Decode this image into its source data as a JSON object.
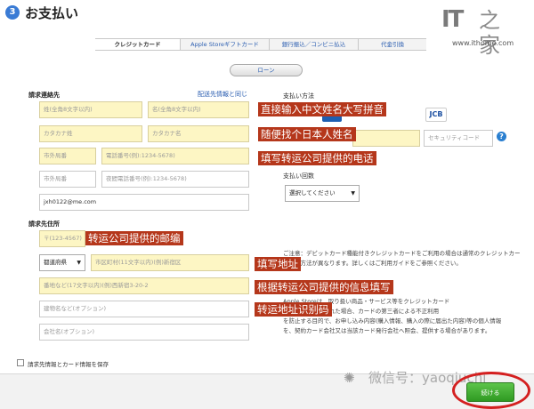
{
  "header": {
    "step_number": "3",
    "title": "お支払い"
  },
  "logo": {
    "it_text": "IT",
    "mark_text": "之家",
    "url": "www.ithome.com"
  },
  "tabs": [
    {
      "label": "クレジットカード",
      "active": true
    },
    {
      "label": "Apple Storeギフトカード",
      "active": false
    },
    {
      "label": "銀行振込／コンビニ払込",
      "active": false
    },
    {
      "label": "代金引換",
      "active": false
    }
  ],
  "loan_button": "ローン",
  "billing": {
    "section_label": "請求連絡先",
    "same_as_link": "配送先情報と同じ",
    "last_name_placeholder": "姓(全角8文字以内)",
    "first_name_placeholder": "名(全角8文字以内)",
    "last_kana_placeholder": "カタカナ姓",
    "first_kana_placeholder": "カタカナ名",
    "area_code_placeholder": "市外局番",
    "phone_placeholder": "電話番号(例):1234-5678)",
    "area_code2_placeholder": "市外局番",
    "phone2_placeholder": "夜間電話番号(例):1234-5678)",
    "email_value": "jxh0122@me.com"
  },
  "address": {
    "section_label": "請求先住所",
    "zip_placeholder": "〒(123-4567)",
    "prefecture_value": "都道府県",
    "city_placeholder": "市区町村(11文字以内)(例)新宿区",
    "street_placeholder": "番地など(17文字以内)(例)西新宿3-20-2",
    "building_placeholder": "建物名など(オプション)",
    "company_placeholder": "会社名(オプション)"
  },
  "payment": {
    "section_label": "支払い方法",
    "security_code_placeholder": "セキュリティコード",
    "help_icon_text": "?",
    "jcb_label": "JCB",
    "installments_label": "支払い回数",
    "installments_select": "選択してください",
    "note_paragraph_1": "ご注意：デビットカード種能付きクレジットカードをご利用の場合は通常のクレジットカー\n手続き方法が異なります。詳しくはご利用ガイドをご参照ください。",
    "note_paragraph_2": "Apple Storeは、取り扱い商品・サービス等をクレジットカード\nを利用して購入された場合、カードの第三者による不正利用\nを防止する目的で、お申し込み内容(購入情報、購入の際に届出た内容)等の個人情報\nを、契約カード会社又は当該カード発行会社へ照会、提供する場合があります。"
  },
  "annotations": {
    "name": "直接输入中文姓名大写拼音",
    "kana": "随便找个日本人姓名",
    "phone": "填写转运公司提供的电话",
    "zip": "转运公司提供的邮编",
    "address": "填写地址",
    "info": "根据转运公司提供的信息填写",
    "code": "转运地址识别码"
  },
  "footer": {
    "save_label": "請求先情報とカード情報を保存",
    "continue_label": "続ける"
  },
  "watermark": {
    "icon": "wechat-icon",
    "text": "微信号：yaoqiuchi"
  }
}
